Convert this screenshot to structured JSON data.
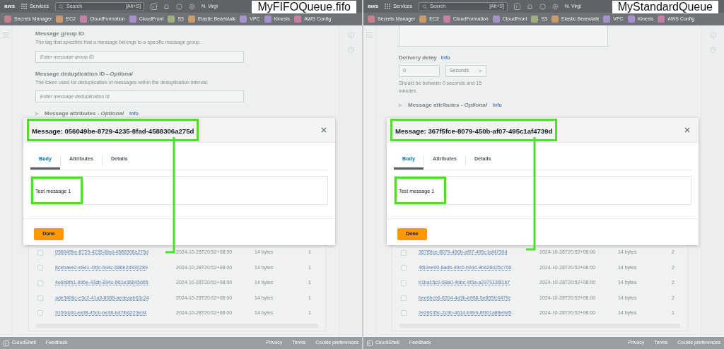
{
  "panels": [
    {
      "caption": "MyFIFOQueue.fifo",
      "top_nav": {
        "logo": "aws",
        "services": "Services",
        "search_placeholder": "Search",
        "shortcut": "[Alt+S]",
        "region": "N. Virgi"
      },
      "favorites": [
        {
          "label": "Secrets Manager",
          "color": "#c9808a"
        },
        {
          "label": "EC2",
          "color": "#cf9a6a"
        },
        {
          "label": "CloudFormation",
          "color": "#c97fa3"
        },
        {
          "label": "CloudFront",
          "color": "#a892cc"
        },
        {
          "label": "S3",
          "color": "#9fb07a"
        },
        {
          "label": "Elastic Beanstalk",
          "color": "#cf9a6a"
        },
        {
          "label": "VPC",
          "color": "#a892cc"
        },
        {
          "label": "Kinesis",
          "color": "#a892cc"
        },
        {
          "label": "AWS Config",
          "color": "#c97fa3"
        }
      ],
      "form": [
        {
          "kind": "text",
          "label": "Message group ID",
          "description": "The tag that specifies that a message belongs to a specific message group.",
          "placeholder": "Enter message group ID"
        },
        {
          "kind": "text",
          "label": "Message deduplication ID - *Optional*",
          "description": "The token used for deduplication of messages within the deduplication interval.",
          "placeholder": "Enter message deduplication id"
        },
        {
          "kind": "expander",
          "label": "Message attributes - *Optional*",
          "info": "Info"
        }
      ],
      "modal": {
        "title": "Message: 056049be-8729-4235-8fad-4588306a275d",
        "title_highlighted": true,
        "tabs": [
          {
            "label": "Body",
            "selected": true
          },
          {
            "label": "Attributes",
            "selected": false
          },
          {
            "label": "Details",
            "selected": false
          }
        ],
        "body": "Test message 1",
        "body_highlighted": true,
        "button": "Done"
      },
      "table": {
        "rows": [
          {
            "checked": false,
            "id": "056049be-8729-4235-8fad-4588306a275d",
            "sent": "2024-10-28T20:52+08:00",
            "size": "14 bytes",
            "count": "1"
          },
          {
            "checked": false,
            "id": "8cebaee2-e841-4fdc-9d4c-686b2d930289",
            "sent": "2024-10-28T20:52+08:00",
            "size": "14 bytes",
            "count": "1"
          },
          {
            "checked": false,
            "id": "4e6b8fb1-996e-43db-894c-861e38845d05",
            "sent": "2024-10-28T20:52+08:00",
            "size": "14 bytes",
            "count": "1"
          },
          {
            "checked": false,
            "id": "ade3406c-e3c2-41a3-8088-aedeaab63c24",
            "sent": "2024-10-28T20:52+08:00",
            "size": "14 bytes",
            "count": "1"
          },
          {
            "checked": false,
            "id": "3150dcfd-ea38-45cb-be38-bd7fb6223e34",
            "sent": "2024-10-28T20:52+08:00",
            "size": "14 bytes",
            "count": "1"
          }
        ]
      },
      "footer": {
        "left": [
          "CloudShell",
          "Feedback"
        ],
        "right": [
          "Privacy",
          "Terms",
          "Cookie preferences"
        ]
      }
    },
    {
      "caption": "MyStandardQueue",
      "top_nav": {
        "logo": "aws",
        "services": "Services",
        "search_placeholder": "Search",
        "shortcut": "[Alt+S]",
        "region": "N. Virgi"
      },
      "favorites": [
        {
          "label": "Secrets Manager",
          "color": "#c9808a"
        },
        {
          "label": "EC2",
          "color": "#cf9a6a"
        },
        {
          "label": "CloudFormation",
          "color": "#c97fa3"
        },
        {
          "label": "CloudFront",
          "color": "#a892cc"
        },
        {
          "label": "S3",
          "color": "#9fb07a"
        },
        {
          "label": "Elastic Beanstalk",
          "color": "#cf9a6a"
        },
        {
          "label": "VPC",
          "color": "#a892cc"
        },
        {
          "label": "Kinesis",
          "color": "#a892cc"
        },
        {
          "label": "AWS Config",
          "color": "#c97fa3"
        }
      ],
      "form": [
        {
          "kind": "textarea"
        },
        {
          "kind": "delay",
          "label": "Delivery delay",
          "info": "Info",
          "value": "0",
          "unit": "Seconds",
          "description": "Should be between 0 seconds and 15 minutes."
        },
        {
          "kind": "expander",
          "label": "Message attributes - *Optional*",
          "info": "Info"
        }
      ],
      "modal": {
        "title": "Message: 367f5fce-8079-450b-af07-495c1af4739d",
        "title_highlighted": true,
        "tabs": [
          {
            "label": "Body",
            "selected": true
          },
          {
            "label": "Attributes",
            "selected": false
          },
          {
            "label": "Details",
            "selected": false
          }
        ],
        "body": "Test message 1",
        "body_highlighted": true,
        "button": "Done"
      },
      "table": {
        "rows": [
          {
            "checked": false,
            "id": "367f5fce-8079-450b-af07-495c1af4739d",
            "sent": "2024-10-28T20:52+08:00",
            "size": "14 bytes",
            "count": "2"
          },
          {
            "checked": false,
            "id": "4f62ee00-8adb-49c0-b0d4-9b626d25c706",
            "sent": "2024-10-28T20:52+08:00",
            "size": "14 bytes",
            "count": "2"
          },
          {
            "checked": false,
            "id": "b1ba15c0-68a0-4bbc-9f3a-a297913f81b7",
            "sent": "2024-10-28T20:52+08:00",
            "size": "14 bytes",
            "count": "2"
          },
          {
            "checked": false,
            "id": "bee6bcb6-6204-4a3b-b968-5e865fc0479c",
            "sent": "2024-10-28T20:52+08:00",
            "size": "14 bytes",
            "count": "2"
          },
          {
            "checked": false,
            "id": "2e26035c-2c9b-461d-b9b9-8f301a88e9d5",
            "sent": "2024-10-28T20:52+08:00",
            "size": "14 bytes",
            "count": "1"
          }
        ]
      },
      "footer": {
        "left": [
          "CloudShell",
          "Feedback"
        ],
        "right": [
          "Privacy",
          "Terms",
          "Cookie preferences"
        ]
      }
    }
  ]
}
